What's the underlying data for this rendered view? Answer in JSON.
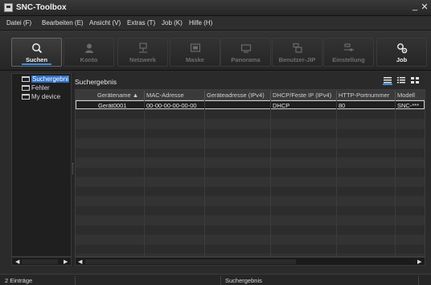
{
  "window": {
    "title": "SNC-Toolbox",
    "minimize": "_",
    "close": "✕"
  },
  "menu": [
    {
      "label": "Datei (F)"
    },
    {
      "label": "Bearbeiten (E)"
    },
    {
      "label": "Ansicht (V)"
    },
    {
      "label": "Extras (T)"
    },
    {
      "label": "Job (K)"
    },
    {
      "label": "Hilfe (H)"
    }
  ],
  "toolbar": {
    "suchen": "Suchen",
    "konto": "Konto",
    "netzwerk": "Netzwerk",
    "maske": "Maske",
    "panorama": "Panorama",
    "benutzer_jip": "Benutzer-JIP",
    "einstellung": "Einstellung",
    "job": "Job"
  },
  "tree": {
    "items": [
      {
        "label": "Suchergebni",
        "selected": true
      },
      {
        "label": "Fehler"
      },
      {
        "label": "My device"
      }
    ]
  },
  "results": {
    "title": "Suchergebnis",
    "columns": [
      "Gerätename ▲",
      "MAC-Adresse",
      "Geräteadresse (IPv4)",
      "DHCP/Feste IP (IPv4)",
      "HTTP-Portnummer",
      "Modell"
    ],
    "rows": [
      [
        "Gerät0001",
        "00-00-00-00-00-00",
        "",
        "DHCP",
        "80",
        "SNC-***"
      ]
    ]
  },
  "status": {
    "count": "2 Einträge",
    "view": "Suchergebnis"
  },
  "colors": {
    "accent": "#3a8ee6",
    "selection": "#2f6fc4"
  }
}
